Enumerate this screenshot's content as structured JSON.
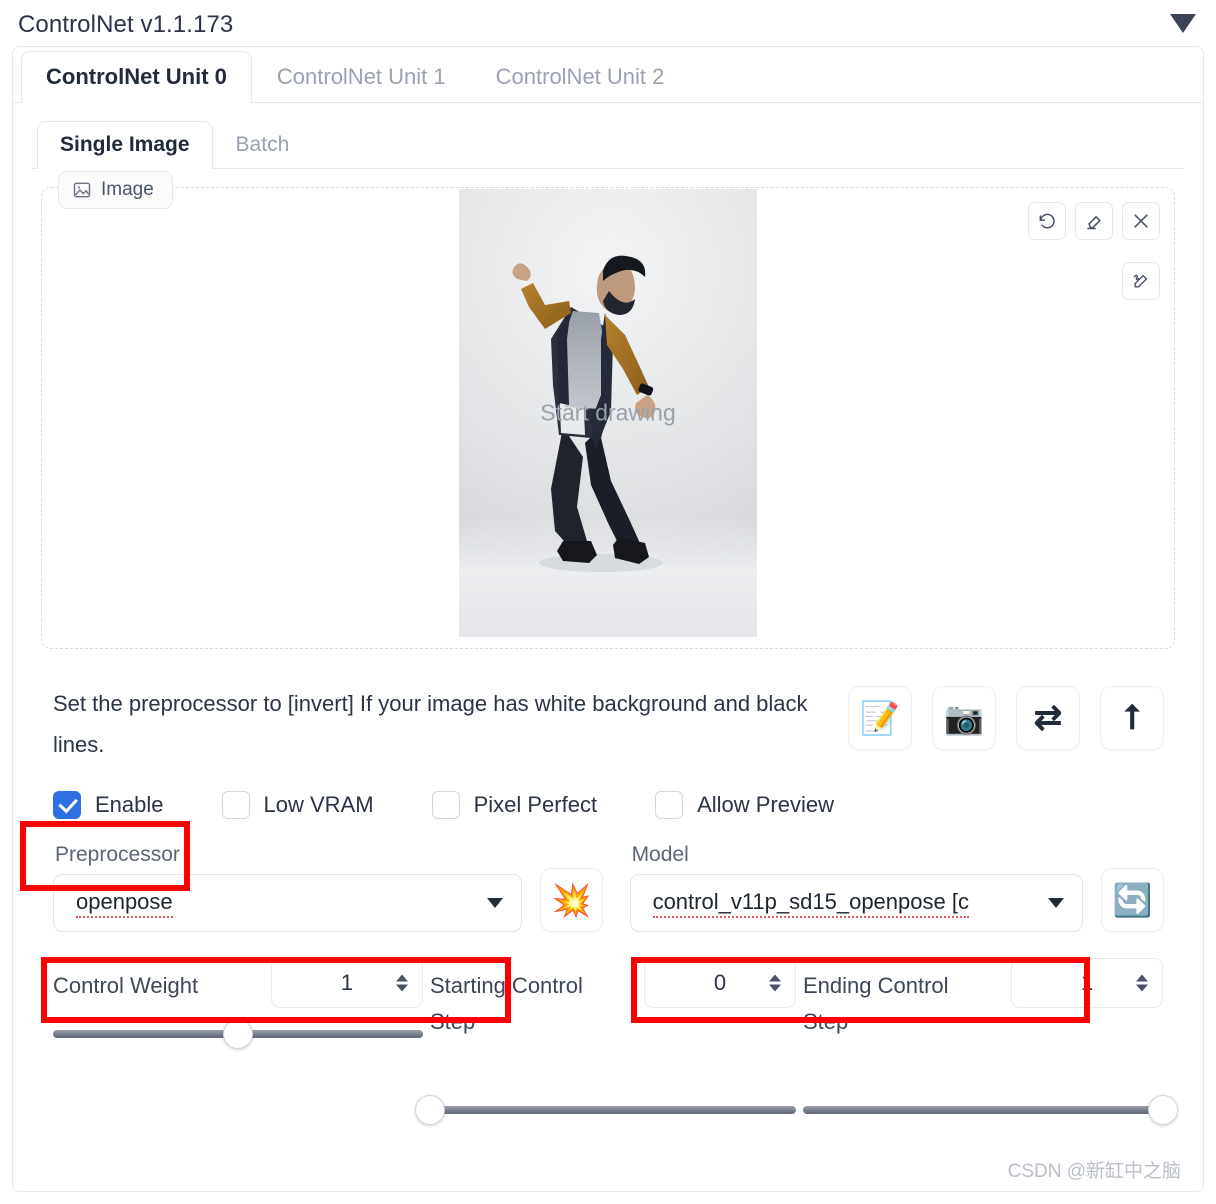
{
  "header": {
    "title": "ControlNet v1.1.173",
    "collapse_icon": "caret-down-icon"
  },
  "unit_tabs": [
    {
      "label": "ControlNet Unit 0",
      "active": true
    },
    {
      "label": "ControlNet Unit 1",
      "active": false
    },
    {
      "label": "ControlNet Unit 2",
      "active": false
    }
  ],
  "source_tabs": [
    {
      "label": "Single Image",
      "active": true
    },
    {
      "label": "Batch",
      "active": false
    }
  ],
  "image_panel": {
    "chip_label": "Image",
    "chip_icon": "image-placeholder-icon",
    "overlay_text": "Start drawing",
    "tools": [
      {
        "name": "undo-icon",
        "title": "undo"
      },
      {
        "name": "eraser-icon",
        "title": "erase"
      },
      {
        "name": "close-icon",
        "title": "remove"
      }
    ],
    "tool_pen": {
      "name": "pen-icon",
      "title": "draw"
    }
  },
  "note": {
    "text": "Set the preprocessor to [invert] If your image has white background and black lines."
  },
  "action_buttons": [
    {
      "name": "open-new-canvas-button",
      "glyph": "📝"
    },
    {
      "name": "webcam-button",
      "glyph": "📷"
    },
    {
      "name": "mirror-webcam-button",
      "glyph": "⇄"
    },
    {
      "name": "send-dimensions-button",
      "glyph": "⭡"
    }
  ],
  "checkboxes": [
    {
      "label": "Enable",
      "checked": true
    },
    {
      "label": "Low VRAM",
      "checked": false
    },
    {
      "label": "Pixel Perfect",
      "checked": false
    },
    {
      "label": "Allow Preview",
      "checked": false
    }
  ],
  "preprocessor": {
    "label": "Preprocessor",
    "value": "openpose"
  },
  "model": {
    "label": "Model",
    "value": "control_v11p_sd15_openpose [c"
  },
  "run_preprocessor_button": {
    "name": "run-preprocessor-button",
    "glyph": "💥"
  },
  "refresh_models_button": {
    "name": "refresh-models-button",
    "glyph": "🔄"
  },
  "sliders": [
    {
      "label": "Control Weight",
      "value": "1",
      "percent": 50
    },
    {
      "label": "Starting Control Step",
      "value": "0",
      "percent": 0
    },
    {
      "label": "Ending Control Step",
      "value": "1",
      "percent": 100
    }
  ],
  "watermark": "CSDN @新缸中之脑",
  "colors": {
    "accent": "#2f6fe4",
    "annotation": "#ff0000",
    "text": "#2b3445",
    "muted": "#9aa2b1"
  }
}
